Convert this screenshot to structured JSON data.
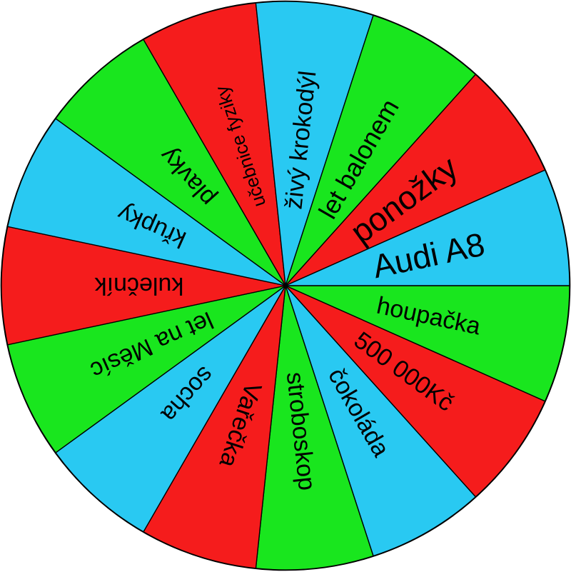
{
  "wheel": {
    "colors": {
      "green": "#19e61e",
      "red": "#f51c1c",
      "blue": "#29c9f2"
    },
    "segments": [
      {
        "label": "houpačka",
        "color": "green"
      },
      {
        "label": "500 000Kč",
        "color": "red"
      },
      {
        "label": "čokoláda",
        "color": "blue"
      },
      {
        "label": "stroboskop",
        "color": "green"
      },
      {
        "label": "Vařečka",
        "color": "red"
      },
      {
        "label": "socha",
        "color": "blue"
      },
      {
        "label": "let na Měsíc",
        "color": "green"
      },
      {
        "label": "kulečník",
        "color": "red"
      },
      {
        "label": "křupky",
        "color": "blue"
      },
      {
        "label": "plavky",
        "color": "green"
      },
      {
        "label": "učebnice fyziky",
        "color": "red"
      },
      {
        "label": "živý krokodýl",
        "color": "blue"
      },
      {
        "label": "let balonem",
        "color": "green"
      },
      {
        "label": "ponožky",
        "color": "red"
      },
      {
        "label": "Audi A8",
        "color": "blue"
      }
    ]
  }
}
